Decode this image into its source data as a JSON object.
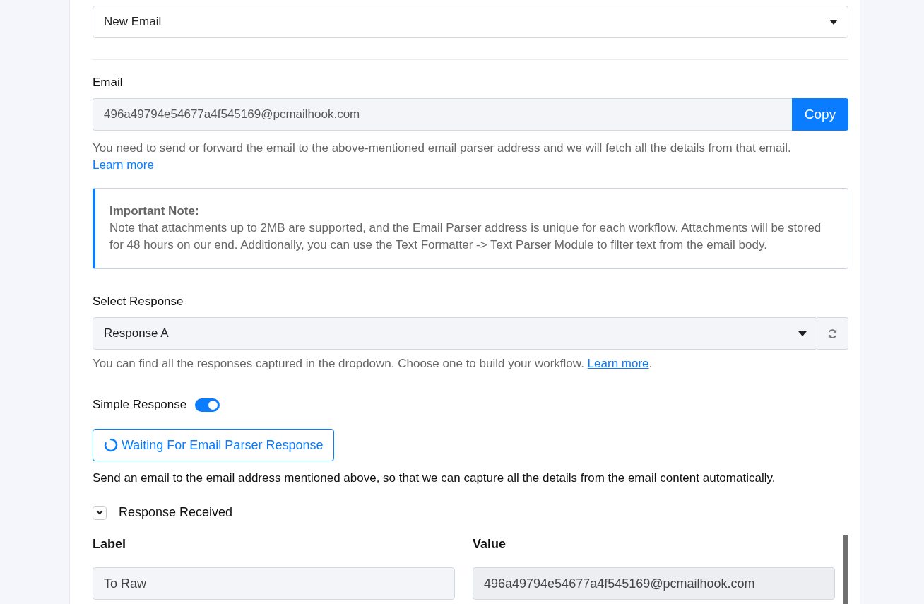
{
  "trigger_select": {
    "value": "New Email"
  },
  "email": {
    "label": "Email",
    "value": "496a49794e54677a4f545169@pcmailhook.com",
    "copy_button": "Copy",
    "help": "You need to send or forward the email to the above-mentioned email parser address and we will fetch all the details from that email.",
    "help_link": "Learn more"
  },
  "note": {
    "title": "Important Note:",
    "body": "Note that attachments up to 2MB are supported, and the Email Parser address is unique for each workflow. Attachments will be stored for 48 hours on our end. Additionally, you can use the Text Formatter -> Text Parser Module to filter text from the email body."
  },
  "response_select": {
    "label": "Select Response",
    "value": "Response A",
    "help": "You can find all the responses captured in the dropdown. Choose one to build your workflow.",
    "help_link": "Learn more",
    "help_end": "."
  },
  "simple_response": {
    "label": "Simple Response",
    "on": true
  },
  "waiting_button": "Waiting For Email Parser Response",
  "instruction": "Send an email to the email address mentioned above, so that we can capture all the details from the email content automatically.",
  "response_received": {
    "label": "Response Received",
    "expanded": true
  },
  "columns": [
    "Label",
    "Value"
  ],
  "rows": [
    {
      "label": "To Raw",
      "value": "496a49794e54677a4f545169@pcmailhook.com"
    }
  ]
}
